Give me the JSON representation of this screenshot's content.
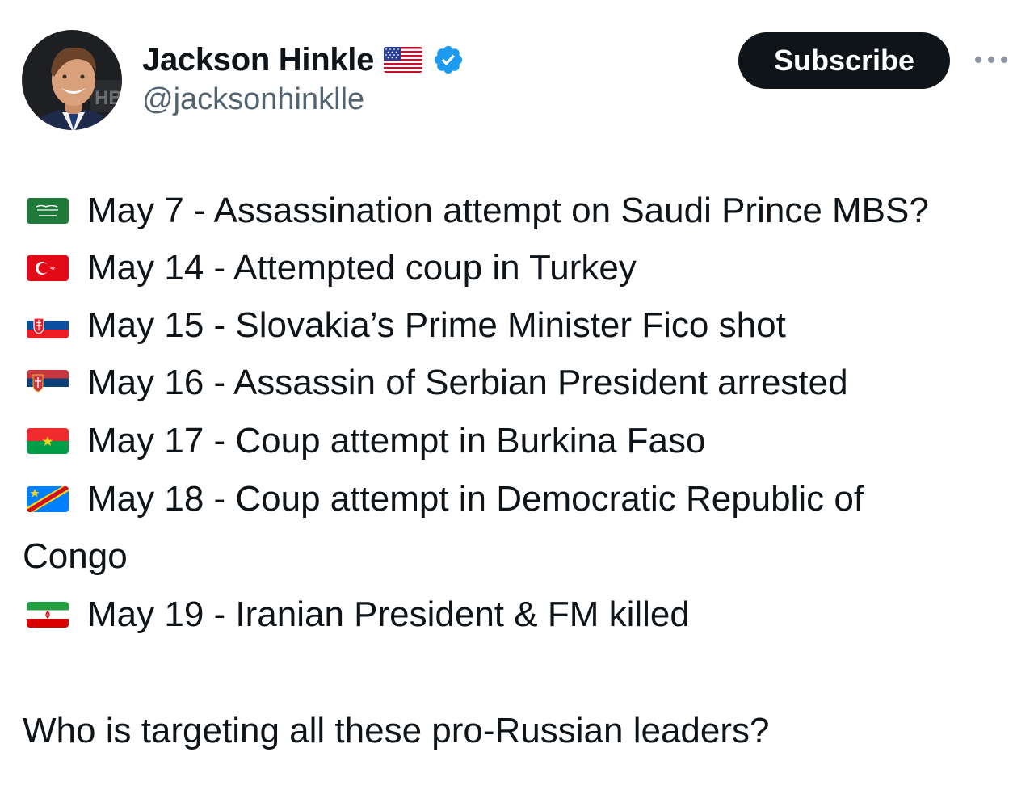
{
  "author": {
    "name": "Jackson Hinkle",
    "name_flag_icon": "us-flag-icon",
    "verified_icon": "verified-badge-icon",
    "handle": "@jacksonhinklle",
    "avatar_backdrop_text": "HB"
  },
  "actions": {
    "subscribe_label": "Subscribe",
    "more_icon": "more-options-icon"
  },
  "tweet": {
    "entries": [
      {
        "flag": "saudi-arabia-flag-icon",
        "text": "May 7 - Assassination attempt on Saudi Prince MBS?"
      },
      {
        "flag": "turkey-flag-icon",
        "text": "May 14 - Attempted coup in Turkey"
      },
      {
        "flag": "slovakia-flag-icon",
        "text": "May 15 - Slovakia’s Prime Minister Fico shot"
      },
      {
        "flag": "serbia-flag-icon",
        "text": "May 16 - Assassin of Serbian President arrested"
      },
      {
        "flag": "burkina-faso-flag-icon",
        "text": "May 17 - Coup attempt in Burkina Faso"
      },
      {
        "flag": "dr-congo-flag-icon",
        "text": "May 18 - Coup attempt in Democratic Republic of",
        "continuation": "Congo"
      },
      {
        "flag": "iran-flag-icon",
        "text": "May 19 - Iranian President & FM killed"
      }
    ],
    "closing": "Who is targeting all these pro-Russian leaders?"
  },
  "colors": {
    "text": "#0f1419",
    "secondary_text": "#536471",
    "verified": "#1d9bf0",
    "button_bg": "#0f1419"
  }
}
